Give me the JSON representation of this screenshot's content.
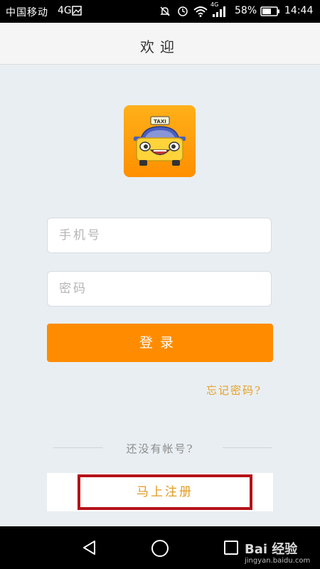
{
  "status_bar": {
    "carrier": "中国移动",
    "network": "4G",
    "small_network": "4G",
    "battery": "58%",
    "time": "14:44",
    "icons": [
      "image-icon",
      "silent-icon",
      "alarm-icon",
      "wifi-icon",
      "signal-icon",
      "battery-icon"
    ]
  },
  "header": {
    "title": "欢迎"
  },
  "logo": {
    "taxi_label": "TAXI",
    "colors": {
      "background": "#ff9a00",
      "car_roof": "#4a5fc0",
      "car_body": "#ffd33a"
    }
  },
  "form": {
    "phone_placeholder": "手机号",
    "password_placeholder": "密码",
    "phone_value": "",
    "password_value": "",
    "login_label": "登录",
    "forgot_label": "忘记密码?"
  },
  "register": {
    "prompt": "还没有帐号?",
    "button_label": "马上注册"
  },
  "watermark": {
    "brand": "Bai 经验",
    "url": "jingyan.baidu.com"
  },
  "colors": {
    "accent": "#ff8c00",
    "link": "#e8a020",
    "highlight_border": "#b51218",
    "background": "#e9eef2"
  }
}
